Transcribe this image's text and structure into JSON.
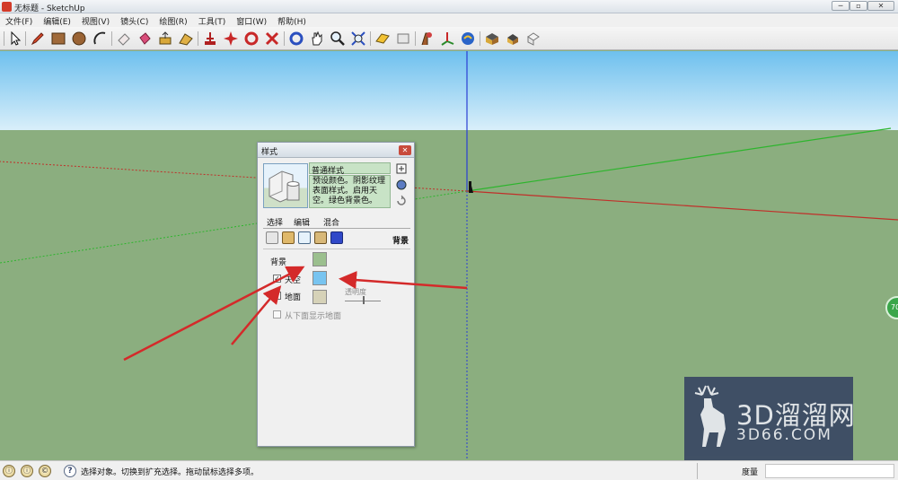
{
  "window": {
    "title": "无标题 - SketchUp",
    "minimize": "─",
    "maximize": "▫",
    "close": "✕"
  },
  "menu": [
    "文件(F)",
    "编辑(E)",
    "视图(V)",
    "镜头(C)",
    "绘图(R)",
    "工具(T)",
    "窗口(W)",
    "帮助(H)"
  ],
  "toolbar_icons": [
    "select-icon",
    "pencil-icon",
    "rectangle-icon",
    "circle-icon",
    "arc-icon",
    "eraser-icon",
    "paint-bucket-icon",
    "push-pull-icon",
    "follow-me-icon",
    "move-icon",
    "rotate-icon",
    "scale-icon",
    "offset-icon",
    "orbit-icon",
    "pan-icon",
    "zoom-icon",
    "zoom-extents-icon",
    "section-plane-icon",
    "measure-tape-icon",
    "text-icon",
    "axes-icon",
    "position-camera-icon",
    "walk-icon",
    "look-around-icon",
    "components-icon",
    "materials-icon",
    "3d-warehouse-icon"
  ],
  "styles_panel": {
    "title": "样式",
    "close": "✕",
    "style_name": "普通样式",
    "description": "预设颜色。阴影纹理表面样式。启用天空。绿色背景色。",
    "tabs": [
      "选择",
      "编辑",
      "混合"
    ],
    "section_heading": "背景",
    "bg_label": "背景",
    "sky_label": "天空",
    "ground_label": "地面",
    "transparency_label": "透明度",
    "show_ground_below_label": "从下面显示地面",
    "sky_checked": true,
    "ground_checked": false,
    "show_ground_below_checked": true,
    "colors": {
      "background": "#9bbf8e",
      "sky": "#78c4f0",
      "ground": "#d6d2b8"
    }
  },
  "status": {
    "text": "选择对象。切换到扩充选择。拖动鼠标选择多项。",
    "help": "?",
    "measure_label": "度量",
    "measure_value": ""
  },
  "watermark": {
    "line1": "3D溜溜网",
    "line2": "3D66.COM"
  },
  "side_badge": "70",
  "accent_colors": {
    "arrow": "#d42a2a",
    "green_axis": "#2db52d",
    "red_axis": "#c0302a",
    "blue_axis": "#2a3fd4"
  }
}
